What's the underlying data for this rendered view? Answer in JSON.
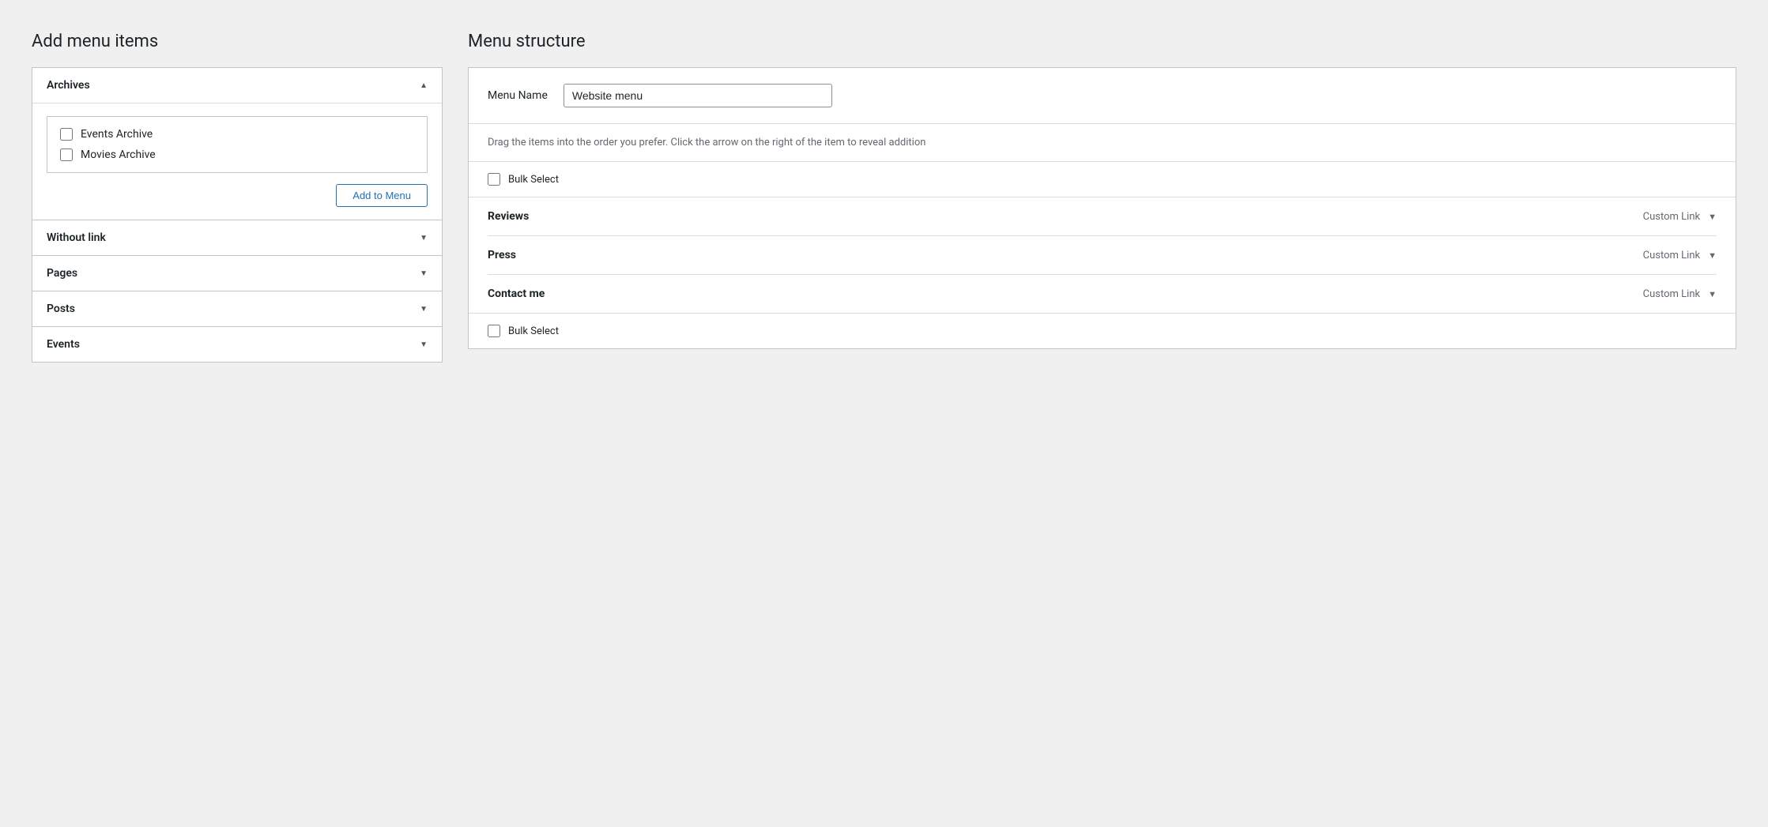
{
  "left": {
    "title": "Add menu items",
    "sections": [
      {
        "id": "archives",
        "label": "Archives",
        "open": true,
        "arrow": "▲",
        "items": [
          {
            "id": "events-archive",
            "label": "Events Archive"
          },
          {
            "id": "movies-archive",
            "label": "Movies Archive"
          }
        ],
        "add_button_label": "Add to Menu"
      },
      {
        "id": "without-link",
        "label": "Without link",
        "open": false,
        "arrow": "▼",
        "items": []
      },
      {
        "id": "pages",
        "label": "Pages",
        "open": false,
        "arrow": "▼",
        "items": []
      },
      {
        "id": "posts",
        "label": "Posts",
        "open": false,
        "arrow": "▼",
        "items": []
      },
      {
        "id": "events",
        "label": "Events",
        "open": false,
        "arrow": "▼",
        "items": []
      }
    ]
  },
  "right": {
    "title": "Menu structure",
    "menu_name_label": "Menu Name",
    "menu_name_value": "Website menu",
    "menu_name_placeholder": "Website menu",
    "instructions": "Drag the items into the order you prefer. Click the arrow on the right of the item to reveal addition",
    "bulk_select_label": "Bulk Select",
    "menu_items": [
      {
        "id": "reviews",
        "name": "Reviews",
        "type": "Custom Link"
      },
      {
        "id": "press",
        "name": "Press",
        "type": "Custom Link"
      },
      {
        "id": "contact-me",
        "name": "Contact me",
        "type": "Custom Link"
      }
    ],
    "bulk_select_bottom_label": "Bulk Select"
  }
}
